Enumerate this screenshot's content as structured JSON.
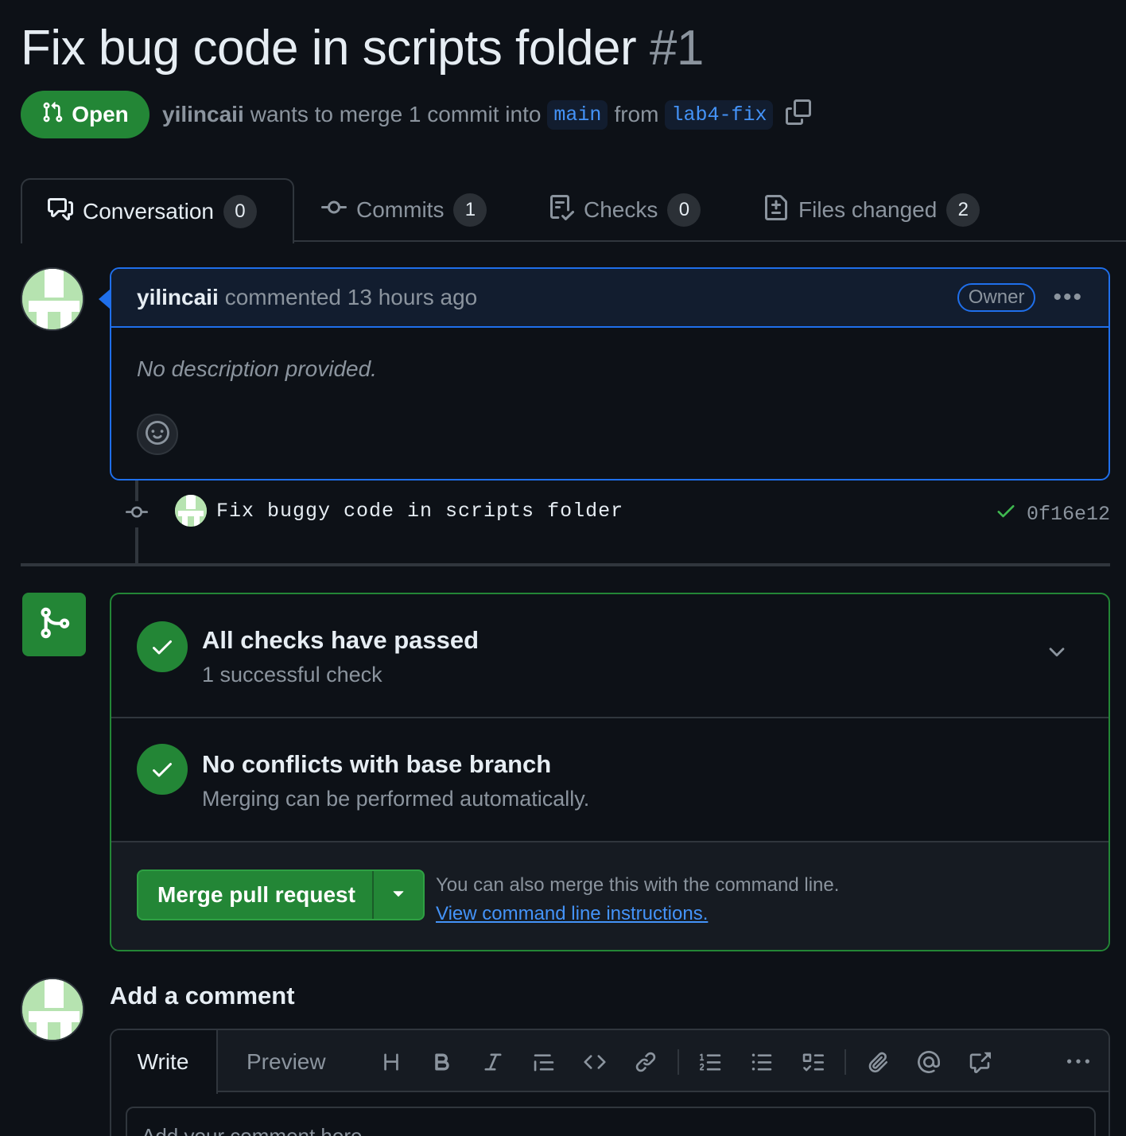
{
  "pr": {
    "title": "Fix bug code in scripts folder",
    "number": "#1",
    "state": "Open",
    "author": "yilincaii",
    "merge_text": "wants to merge 1 commit into",
    "base_branch": "main",
    "from_text": "from",
    "head_branch": "lab4-fix"
  },
  "tabs": [
    {
      "label": "Conversation",
      "count": "0"
    },
    {
      "label": "Commits",
      "count": "1"
    },
    {
      "label": "Checks",
      "count": "0"
    },
    {
      "label": "Files changed",
      "count": "2"
    }
  ],
  "comment": {
    "author": "yilincaii",
    "action": "commented 13 hours ago",
    "role": "Owner",
    "body": "No description provided."
  },
  "commit": {
    "message": "Fix buggy code in scripts folder",
    "sha": "0f16e12"
  },
  "merge": {
    "checks_title": "All checks have passed",
    "checks_sub": "1 successful check",
    "conflicts_title": "No conflicts with base branch",
    "conflicts_sub": "Merging can be performed automatically.",
    "button_label": "Merge pull request",
    "cli_text": "You can also merge this with the command line.",
    "cli_link": "View command line instructions."
  },
  "add_comment": {
    "title": "Add a comment",
    "write_tab": "Write",
    "preview_tab": "Preview",
    "placeholder": "Add your comment here..."
  },
  "colors": {
    "background": "#0d1117",
    "accent_green": "#238636",
    "accent_blue": "#1f6feb",
    "link": "#4493f8"
  }
}
